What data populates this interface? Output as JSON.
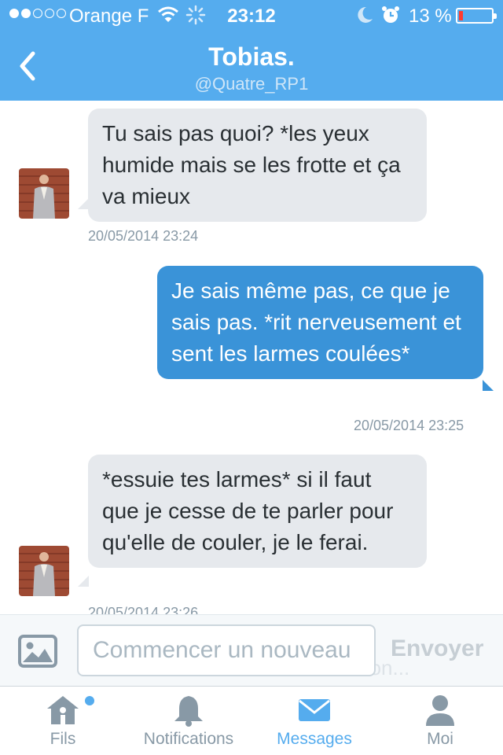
{
  "status_bar": {
    "carrier": "Orange F",
    "time": "23:12",
    "battery": "13 %",
    "battery_level": 0.13
  },
  "header": {
    "title": "Tobias.",
    "handle": "@Quatre_RP1"
  },
  "messages": [
    {
      "direction": "in",
      "text": "Tu sais pas quoi? *les yeux humide mais se les frotte et ça va mieux",
      "timestamp": "20/05/2014 23:24"
    },
    {
      "direction": "out",
      "text": "Je sais même pas, ce que je sais pas. *rit nerveusement et sent les larmes coulées*",
      "timestamp": "20/05/2014 23:25"
    },
    {
      "direction": "in",
      "text": "*essuie tes larmes* si il faut que je cesse de te parler pour qu'elle de couler, je le ferai.",
      "timestamp": "20/05/2014 23:26"
    }
  ],
  "compose": {
    "placeholder": "Commencer un nouveau",
    "send_label": "Envoyer",
    "ghost_text": "e* Non..."
  },
  "tabs": [
    {
      "label": "Fils",
      "icon": "home-icon"
    },
    {
      "label": "Notifications",
      "icon": "bell-icon"
    },
    {
      "label": "Messages",
      "icon": "envelope-icon",
      "active": true
    },
    {
      "label": "Moi",
      "icon": "person-icon"
    }
  ],
  "colors": {
    "brand": "#55acee",
    "outgoing_bubble": "#3a93d8",
    "incoming_bubble": "#e6e9ed"
  }
}
